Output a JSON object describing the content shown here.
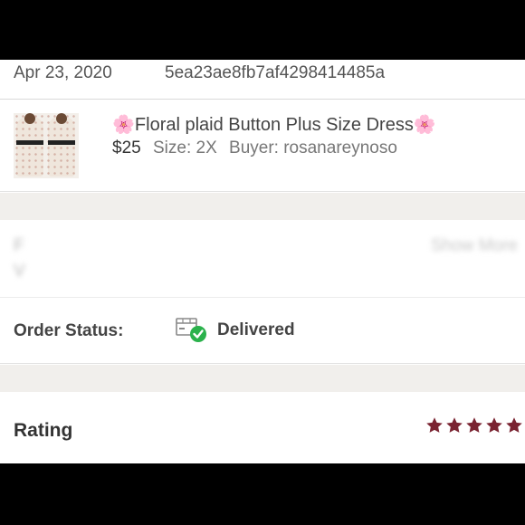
{
  "order": {
    "date": "Apr 23, 2020",
    "id": "5ea23ae8fb7af4298414485a"
  },
  "item": {
    "thumbnail_icon": "dress-thumbnail",
    "title_prefix_emoji": "🌸",
    "title": "Floral plaid Button Plus Size Dress",
    "title_suffix_emoji": "🌸",
    "price": "$25",
    "size": "Size: 2X",
    "buyer": "Buyer: rosanareynoso"
  },
  "obscured_row": {
    "text1": "F",
    "text2": "V",
    "more": "Show More"
  },
  "status": {
    "label": "Order Status:",
    "icon": "box-check-icon",
    "value": "Delivered",
    "check_color": "#2bb24c"
  },
  "rating": {
    "label": "Rating",
    "stars": 5,
    "star_color": "#7a2331"
  }
}
